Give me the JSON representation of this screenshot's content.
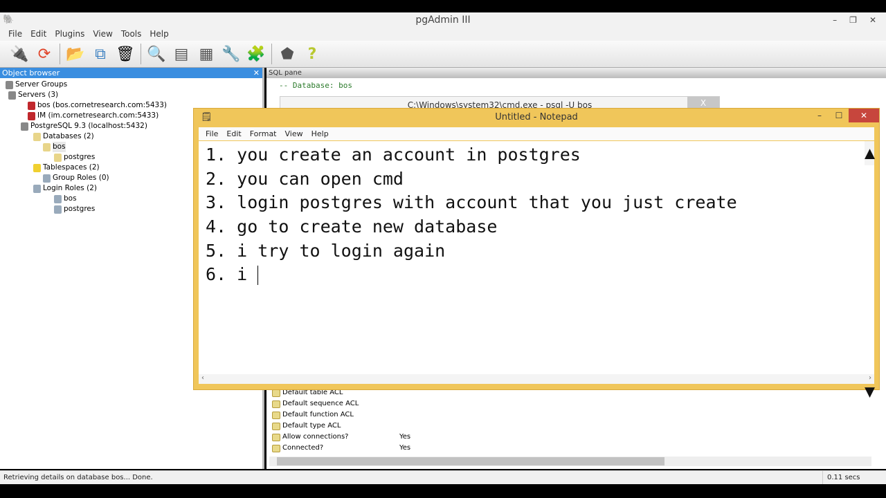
{
  "app": {
    "title": "pgAdmin III",
    "menu": [
      "File",
      "Edit",
      "Plugins",
      "View",
      "Tools",
      "Help"
    ],
    "toolbar": [
      "connect-icon",
      "refresh-icon",
      "properties-icon",
      "create-icon",
      "delete-icon",
      "sql-query-icon",
      "view-data-icon",
      "filtered-data-icon",
      "maintenance-icon",
      "plugins-icon",
      "guru-hint-icon",
      "help-icon"
    ]
  },
  "object_browser": {
    "title": "Object browser",
    "close": "✕",
    "items": [
      {
        "label": "Server Groups",
        "color": "#888"
      },
      {
        "label": "Servers (3)",
        "color": "#888"
      },
      {
        "label": "bos (bos.cornetresearch.com:5433)",
        "color": "#c0282d"
      },
      {
        "label": "IM (im.cornetresearch.com:5433)",
        "color": "#c0282d"
      },
      {
        "label": "PostgreSQL 9.3 (localhost:5432)",
        "color": "#888"
      },
      {
        "label": "Databases (2)",
        "color": "#e8d58a"
      },
      {
        "label": "bos",
        "color": "#e8d58a"
      },
      {
        "label": "postgres",
        "color": "#e8d58a"
      },
      {
        "label": "Tablespaces (2)",
        "color": "#f0d030"
      },
      {
        "label": "Group Roles (0)",
        "color": "#9ab"
      },
      {
        "label": "Login Roles (2)",
        "color": "#9ab"
      },
      {
        "label": "bos",
        "color": "#9ab"
      },
      {
        "label": "postgres",
        "color": "#9ab"
      }
    ]
  },
  "sql_pane": {
    "title": "SQL pane",
    "text": "-- Database: bos"
  },
  "cmd_window": {
    "title": "C:\\Windows\\system32\\cmd.exe - psql  -U bos",
    "close": "X"
  },
  "properties": [
    {
      "name": "Default table ACL",
      "value": ""
    },
    {
      "name": "Default sequence ACL",
      "value": ""
    },
    {
      "name": "Default function ACL",
      "value": ""
    },
    {
      "name": "Default type ACL",
      "value": ""
    },
    {
      "name": "Allow connections?",
      "value": "Yes"
    },
    {
      "name": "Connected?",
      "value": "Yes"
    }
  ],
  "status": {
    "message": "Retrieving details on database bos... Done.",
    "time": "0.11 secs"
  },
  "notepad": {
    "title": "Untitled - Notepad",
    "menu": [
      "File",
      "Edit",
      "Format",
      "View",
      "Help"
    ],
    "lines": [
      "1. you create an account in postgres",
      "2. you can open cmd",
      "3. login postgres with account that you just create",
      "4. go to create new database",
      "5. i try to login again",
      "6. i "
    ],
    "title_color": "#f0c65a"
  }
}
